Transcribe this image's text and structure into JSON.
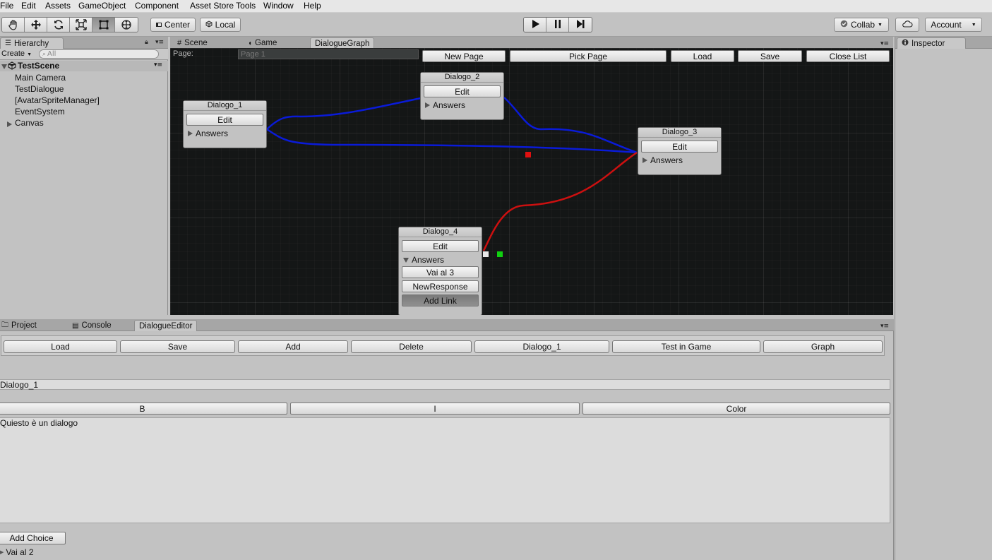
{
  "menu": [
    "File",
    "Edit",
    "Assets",
    "GameObject",
    "Component",
    "Asset Store Tools",
    "Window",
    "Help"
  ],
  "toolbar": {
    "pivot_label": "Center",
    "space_label": "Local",
    "collab_label": "Collab",
    "account_label": "Account"
  },
  "hierarchy": {
    "tab": "Hierarchy",
    "create_label": "Create",
    "search_placeholder": "All",
    "scene": "TestScene",
    "items": [
      "Main Camera",
      "TestDialogue",
      "[AvatarSpriteManager]",
      "EventSystem",
      "Canvas"
    ]
  },
  "center_tabs": [
    "Scene",
    "Game",
    "DialogueGraph"
  ],
  "graph": {
    "page_label": "Page:",
    "page_value": "Page 1",
    "buttons": [
      "New Page",
      "Pick Page",
      "Load",
      "Save",
      "Close List"
    ],
    "nodes": [
      {
        "title": "Dialogo_1",
        "edit": "Edit",
        "fold": "Answers"
      },
      {
        "title": "Dialogo_2",
        "edit": "Edit",
        "fold": "Answers"
      },
      {
        "title": "Dialogo_3",
        "edit": "Edit",
        "fold": "Answers"
      },
      {
        "title": "Dialogo_4",
        "edit": "Edit",
        "fold": "Answers",
        "answers": [
          "Vai al 3",
          "NewResponse"
        ],
        "add_link": "Add Link"
      }
    ],
    "colors": {
      "link_blue": "#0a1bd8",
      "link_red": "#cc1010",
      "marker_red": "#e01010",
      "marker_green": "#10d010",
      "marker_white": "#e8e8e8"
    }
  },
  "bottom_tabs": [
    "Project",
    "Console",
    "DialogueEditor"
  ],
  "editor": {
    "buttons": [
      "Load",
      "Save",
      "Add",
      "Delete",
      "Dialogo_1",
      "Test in Game",
      "Graph"
    ],
    "name_value": "Dialogo_1",
    "format_buttons": [
      "B",
      "I",
      "Color"
    ],
    "text_value": "Quiesto è un  dialogo",
    "add_choice": "Add Choice",
    "choice_item": "Vai al 2"
  },
  "inspector": {
    "tab": "Inspector"
  }
}
